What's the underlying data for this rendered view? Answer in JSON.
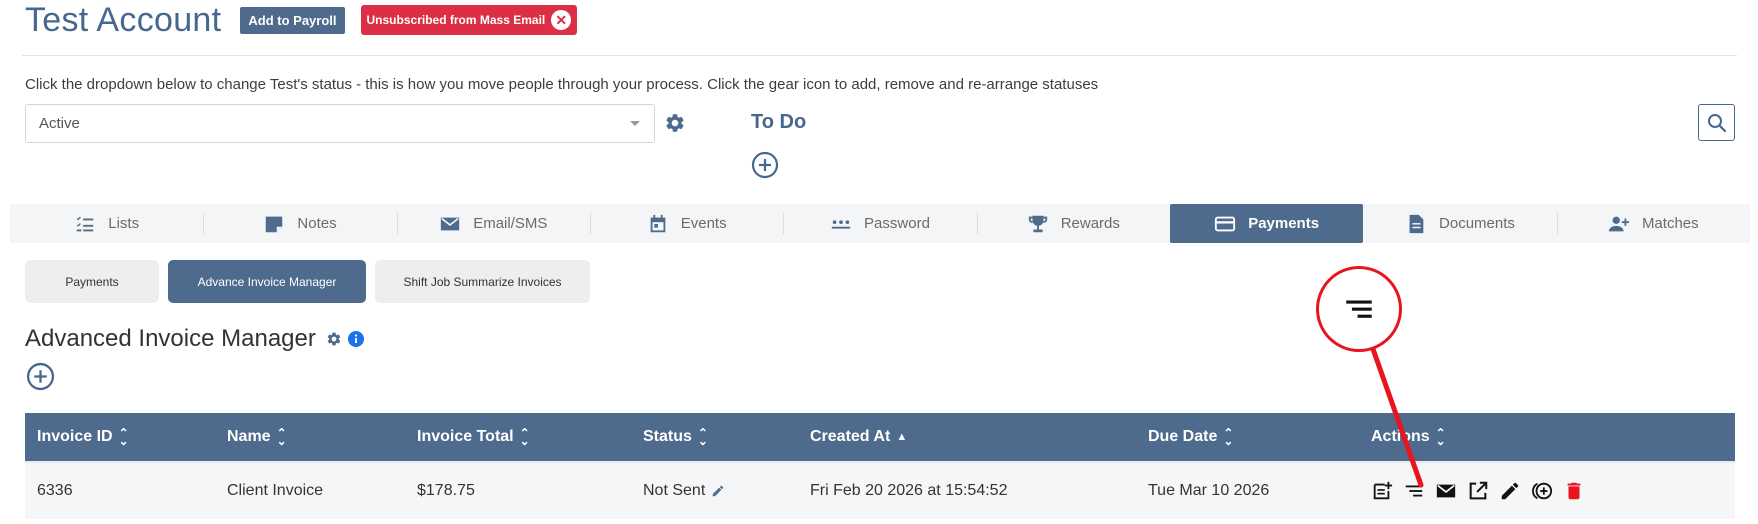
{
  "header": {
    "title": "Test Account",
    "payroll_button": "Add to Payroll",
    "unsubscribed_badge": "Unsubscribed from Mass Email",
    "badge_close_glyph": "✕"
  },
  "status": {
    "help_text": "Click the dropdown below to change Test's status - this is how you move people through your process. Click the gear icon to add, remove and re-arrange statuses",
    "selected": "Active"
  },
  "todo": {
    "title": "To Do"
  },
  "tabs": [
    {
      "label": "Lists",
      "icon": "checklist-icon"
    },
    {
      "label": "Notes",
      "icon": "note-icon"
    },
    {
      "label": "Email/SMS",
      "icon": "envelope-icon"
    },
    {
      "label": "Events",
      "icon": "calendar-icon"
    },
    {
      "label": "Password",
      "icon": "password-icon"
    },
    {
      "label": "Rewards",
      "icon": "trophy-icon"
    },
    {
      "label": "Payments",
      "icon": "credit-card-icon",
      "active": true
    },
    {
      "label": "Documents",
      "icon": "document-icon"
    },
    {
      "label": "Matches",
      "icon": "user-add-icon"
    }
  ],
  "subtabs": [
    {
      "label": "Payments"
    },
    {
      "label": "Advance Invoice Manager",
      "active": true
    },
    {
      "label": "Shift Job Summarize Invoices"
    }
  ],
  "section": {
    "title": "Advanced Invoice Manager"
  },
  "table": {
    "headers": [
      "Invoice ID",
      "Name",
      "Invoice Total",
      "Status",
      "Created At",
      "Due Date",
      "Actions"
    ],
    "rows": [
      {
        "invoice_id": "6336",
        "name": "Client Invoice",
        "total": "$178.75",
        "status": "Not Sent",
        "created_at": "Fri Feb 20 2026 at 15:54:52",
        "due_date": "Tue Mar 10 2026"
      }
    ]
  },
  "colors": {
    "primary": "#4e6a8d",
    "title": "#46678f",
    "danger": "#dc2f45",
    "callout": "#e8141e"
  }
}
